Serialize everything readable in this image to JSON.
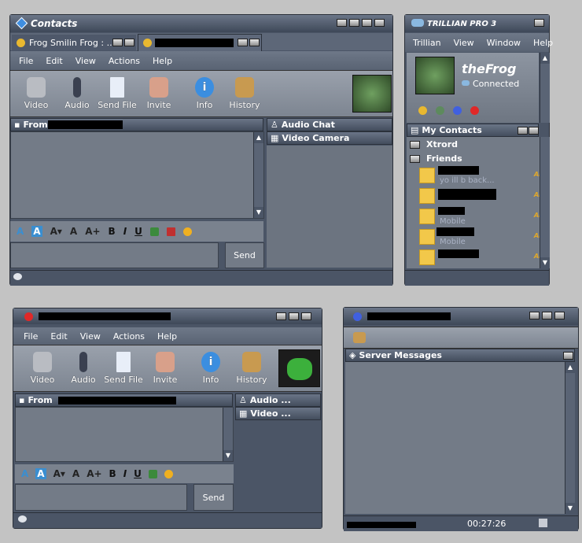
{
  "chat1": {
    "title": "Contacts",
    "tabs": [
      "Frog Smilin Frog : ..."
    ],
    "menu": [
      "File",
      "Edit",
      "View",
      "Actions",
      "Help"
    ],
    "tools": [
      "Video",
      "Audio",
      "Send File",
      "Invite",
      "Info",
      "History"
    ],
    "from": "From",
    "audio": "Audio Chat",
    "video": "Video Camera",
    "send": "Send"
  },
  "chat2": {
    "menu": [
      "File",
      "Edit",
      "View",
      "Actions",
      "Help"
    ],
    "tools": [
      "Video",
      "Audio",
      "Send File",
      "Invite",
      "Info",
      "History"
    ],
    "from": "From",
    "audio": "Audio ...",
    "video": "Video ...",
    "send": "Send"
  },
  "format": [
    "A",
    "A",
    "A▾",
    "A",
    "A+",
    "B",
    "I",
    "U"
  ],
  "trillian": {
    "brand": "TRILLIAN PRO 3",
    "menu": [
      "Trillian",
      "View",
      "Window",
      "Help"
    ],
    "user": "theFrog",
    "status": "Connected",
    "contacts_header": "My Contacts",
    "groups": [
      "Xtrord",
      "Friends"
    ],
    "contacts": [
      {
        "sub": "yo ill b back...",
        "proto": "AIM"
      },
      {
        "sub": "",
        "proto": "AIM"
      },
      {
        "sub": "Mobile",
        "proto": "AIM"
      },
      {
        "sub": "Mobile",
        "proto": "AIM"
      },
      {
        "sub": "",
        "proto": "AIM"
      }
    ]
  },
  "server": {
    "header": "Server Messages",
    "time": "00:27:26"
  }
}
